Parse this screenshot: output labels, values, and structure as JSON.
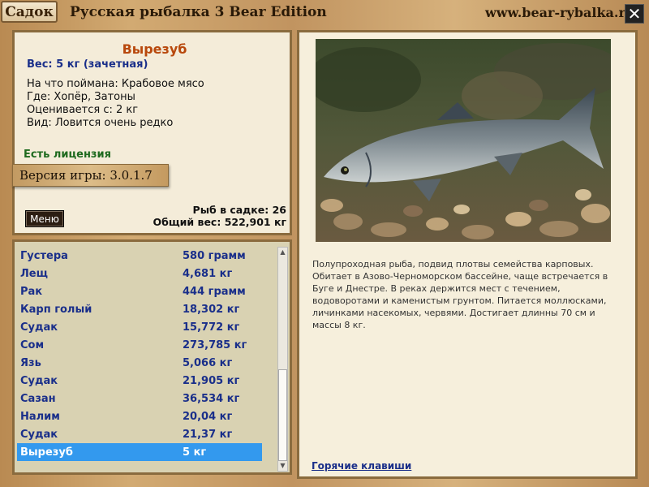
{
  "titlebar": {
    "tab_label": "Садок",
    "app_title": "Русская рыбалка 3 Bear Edition",
    "site": "www.bear-rybalka.ru",
    "close_label": "✕"
  },
  "info": {
    "fish_name": "Вырезуб",
    "weight": "Вес: 5 кг (зачетная)",
    "lines": [
      "На что поймана: Крабовое мясо",
      "Где: Хопёр, Затоны",
      "Оценивается с: 2 кг",
      "Вид: Ловится очень редко"
    ],
    "license": "Есть лицензия",
    "version": "Версия игры: 3.0.1.7",
    "menu_label": "Меню",
    "count": "Рыб в садке: 26",
    "total": "Общий вес: 522,901 кг"
  },
  "catch_list": [
    {
      "name": "Густера",
      "weight": "580 грамм"
    },
    {
      "name": "Лещ",
      "weight": "4,681 кг"
    },
    {
      "name": "Рак",
      "weight": "444 грамм"
    },
    {
      "name": "Карп голый",
      "weight": "18,302 кг"
    },
    {
      "name": "Судак",
      "weight": "15,772 кг"
    },
    {
      "name": "Сом",
      "weight": "273,785 кг"
    },
    {
      "name": "Язь",
      "weight": "5,066 кг"
    },
    {
      "name": "Судак",
      "weight": "21,905 кг"
    },
    {
      "name": "Сазан",
      "weight": "36,534 кг"
    },
    {
      "name": "Налим",
      "weight": "20,04 кг"
    },
    {
      "name": "Судак",
      "weight": "21,37 кг"
    },
    {
      "name": "Вырезуб",
      "weight": "5 кг",
      "selected": true
    }
  ],
  "description": "Полупроходная рыба, подвид плотвы семейства карповых. Обитает в Азово-Черноморском бассейне, чаще встречается в Буге и Днестре. В реках держится мест с течением, водоворотами и каменистым грунтом. Питается моллюсками, личинками насекомых, червями.  Достигает длинны 70 см и массы 8 кг.",
  "hotkeys_label": "Горячие клавиши",
  "colors": {
    "fish_name": "#b8480c",
    "list_text": "#1a2f8a",
    "selected_row": "#3399ee",
    "license": "#1e6a1e"
  }
}
